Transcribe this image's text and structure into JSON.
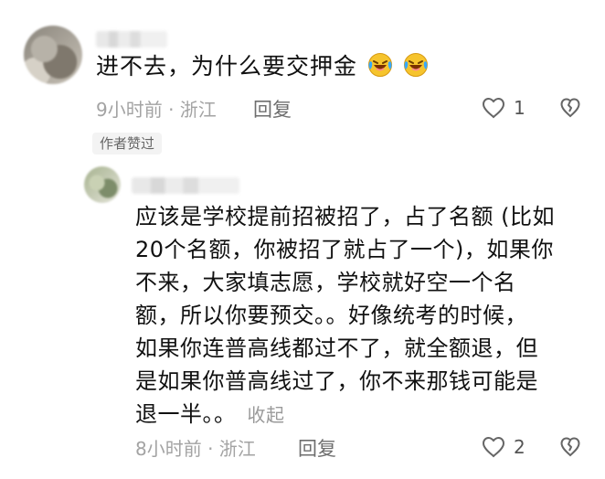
{
  "main_comment": {
    "text": "进不去，为什么要交押金",
    "emojis": [
      "laughing-crying-emoji",
      "laughing-crying-emoji"
    ],
    "meta": "9小时前 · 浙江",
    "reply_label": "回复",
    "like_count": "1",
    "author_badge": "作者赞过"
  },
  "reply_comment": {
    "lines": [
      "应该是学校提前招被招了，占了名额 (比如",
      "20个名额，你被招了就占了一个)，如果你",
      "不来，大家填志愿，学校就好空一个名",
      "额，所以你要预交。。好像统考的时候，",
      "如果你连普高线都过不了，就全额退，但",
      "是如果你普高线过了，你不来那钱可能是",
      "退一半。。"
    ],
    "collapse_label": "收起",
    "meta": "8小时前 · 浙江",
    "reply_label": "回复",
    "like_count": "2"
  },
  "icons": {
    "like": "heart-outline-icon",
    "dislike": "broken-heart-outline-icon",
    "emoji": "face-with-tears-of-joy"
  },
  "colors": {
    "text": "#111111",
    "muted": "#a3a3a3",
    "reply": "#6e6e6e",
    "badge_bg": "#f3f3f3",
    "emoji_yellow": "#f6c42d",
    "emoji_blue": "#37a8ff"
  }
}
